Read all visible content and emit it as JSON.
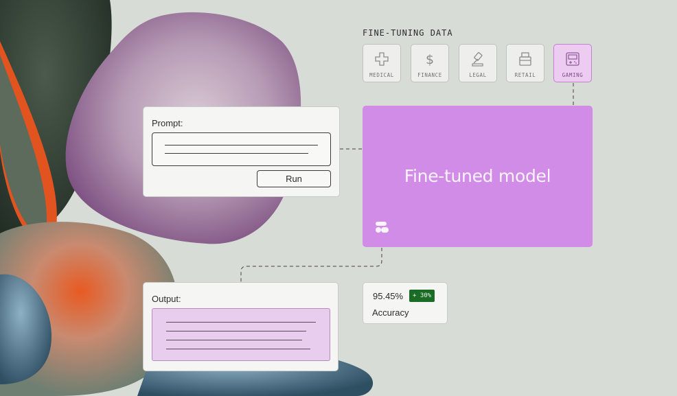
{
  "fine_tuning": {
    "title": "FINE-TUNING DATA",
    "domains": [
      {
        "label": "MEDICAL",
        "icon": "plus-icon",
        "active": false
      },
      {
        "label": "FINANCE",
        "icon": "dollar-icon",
        "active": false
      },
      {
        "label": "LEGAL",
        "icon": "gavel-icon",
        "active": false
      },
      {
        "label": "RETAIL",
        "icon": "register-icon",
        "active": false
      },
      {
        "label": "GAMING",
        "icon": "gamepad-icon",
        "active": true
      }
    ]
  },
  "prompt": {
    "label": "Prompt:",
    "run_label": "Run"
  },
  "model": {
    "title": "Fine-tuned model",
    "color": "#d08ce6"
  },
  "output": {
    "label": "Output:"
  },
  "metric": {
    "value": "95.45%",
    "delta": "+ 30%",
    "label": "Accuracy",
    "delta_color": "#1a6b25"
  }
}
